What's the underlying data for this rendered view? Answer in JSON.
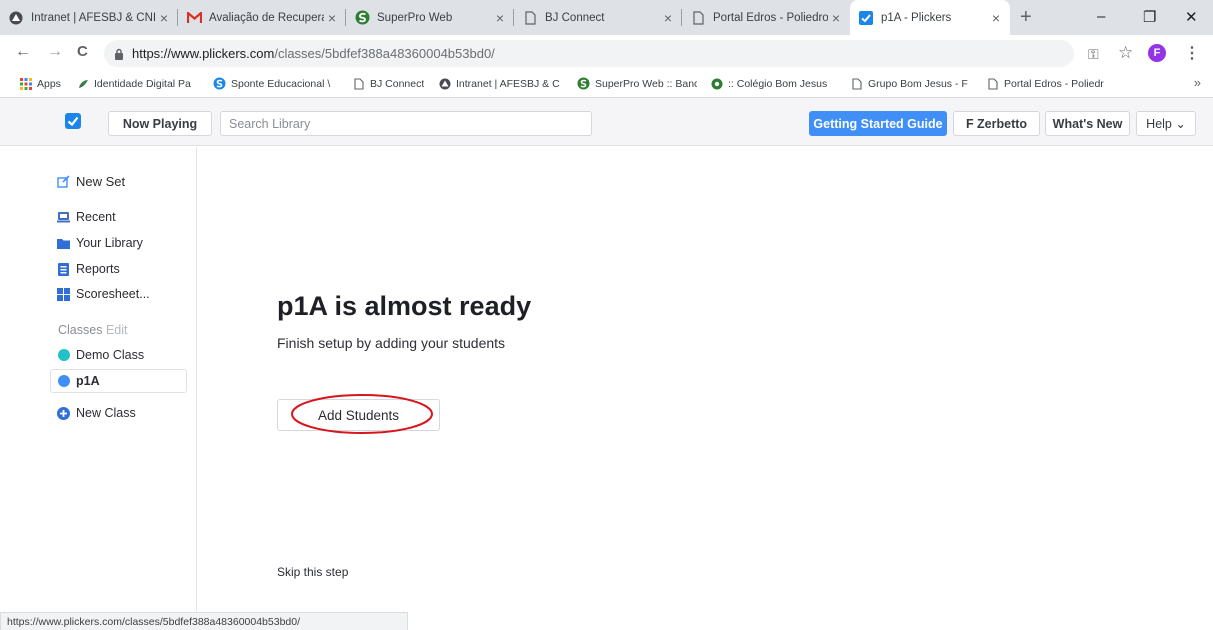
{
  "browser": {
    "tabs": [
      {
        "label": "Intranet | AFESBJ & CNI",
        "icon": "afesbj-icon"
      },
      {
        "label": "Avaliação de Recuperação",
        "icon": "gmail-icon"
      },
      {
        "label": "SuperPro Web",
        "icon": "superpro-icon"
      },
      {
        "label": "BJ Connect",
        "icon": "page-icon"
      },
      {
        "label": "Portal Edros - Poliedro",
        "icon": "page-icon"
      },
      {
        "label": "p1A - Plickers",
        "icon": "plickers-icon",
        "active": true
      }
    ],
    "close_glyph": "×",
    "newtab_glyph": "+",
    "window_controls": {
      "minimize": "–",
      "restore": "❐",
      "close": "✕"
    },
    "nav": {
      "back": "←",
      "forward": "→",
      "reload": "C"
    },
    "url": {
      "host": "https://www.plickers.com",
      "path": "/classes/5bdfef388a48360004b53bd0/"
    },
    "profile_initial": "F",
    "menu_glyph": "⋮",
    "star_glyph": "☆",
    "key_glyph": "⚿",
    "bookmarks": [
      {
        "label": "Apps",
        "icon": "apps-grid-icon"
      },
      {
        "label": "Identidade Digital Pa",
        "icon": "identidade-icon"
      },
      {
        "label": "Sponte Educacional \\",
        "icon": "sponte-icon"
      },
      {
        "label": "BJ Connect",
        "icon": "page-icon"
      },
      {
        "label": "Intranet | AFESBJ & C",
        "icon": "afesbj-icon"
      },
      {
        "label": "SuperPro Web :: Banc",
        "icon": "superpro-icon"
      },
      {
        "label": ":: Colégio Bom Jesus",
        "icon": "bomjesus-icon"
      },
      {
        "label": "Grupo Bom Jesus - F",
        "icon": "page-icon"
      },
      {
        "label": "Portal Edros - Poliedr",
        "icon": "page-icon"
      }
    ],
    "bookmarks_more": "»"
  },
  "header": {
    "now_playing": "Now Playing",
    "search_placeholder": "Search Library",
    "getting_started": "Getting Started Guide",
    "user": "F Zerbetto",
    "whats_new": "What's New",
    "help": "Help ⌄"
  },
  "sidebar": {
    "new_set": "New Set",
    "nav": [
      {
        "label": "Recent",
        "icon": "recent-icon"
      },
      {
        "label": "Your Library",
        "icon": "folder-icon"
      },
      {
        "label": "Reports",
        "icon": "reports-icon"
      },
      {
        "label": "Scoresheet...",
        "icon": "scoresheet-icon"
      }
    ],
    "classes_heading": "Classes",
    "classes_edit": "Edit",
    "classes": [
      {
        "label": "Demo Class",
        "color": "#21c2c6"
      },
      {
        "label": "p1A",
        "color": "#3f8ff7",
        "active": true
      }
    ],
    "new_class": "New Class"
  },
  "main": {
    "title": "p1A is almost ready",
    "subtitle": "Finish setup by adding your students",
    "add_students": "Add Students",
    "skip": "Skip this step"
  },
  "status_url": "https://www.plickers.com/classes/5bdfef388a48360004b53bd0/",
  "colors": {
    "accent": "#3f8ff7",
    "annotation": "#d8141c"
  }
}
